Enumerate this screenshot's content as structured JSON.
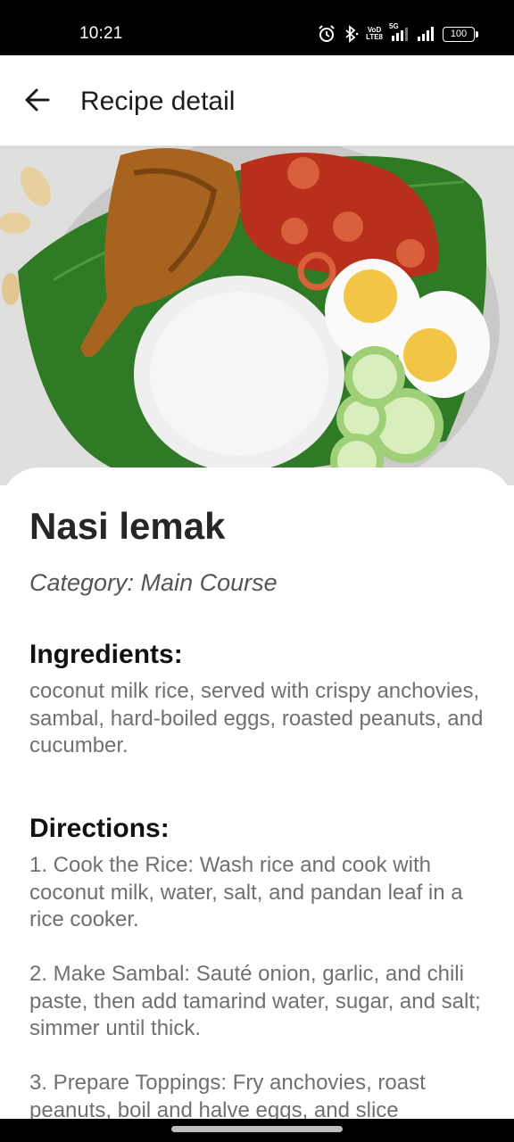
{
  "status_bar": {
    "time": "10:21",
    "icons": [
      "alarm-icon",
      "bluetooth-icon",
      "volte-icon",
      "signal-5g-icon",
      "signal-icon",
      "battery-icon"
    ],
    "volte_label_top": "VoD",
    "volte_label_bottom": "LTE8",
    "network_label": "5G",
    "battery_level": "100"
  },
  "app_bar": {
    "title": "Recipe detail",
    "back_icon": "arrow-left-icon"
  },
  "recipe": {
    "name": "Nasi lemak",
    "category": "Category: Main Course",
    "ingredients_title": "Ingredients:",
    "ingredients_text": "coconut milk rice, served with crispy anchovies, sambal, hard-boiled eggs, roasted peanuts, and cucumber.",
    "directions_title": "Directions:",
    "directions": [
      "1. Cook the Rice: Wash rice and cook with coconut milk, water, salt, and pandan leaf in a rice cooker.",
      "2. Make Sambal: Sauté onion, garlic, and chili paste, then add tamarind water, sugar, and salt; simmer until thick.",
      "3. Prepare Toppings: Fry anchovies, roast peanuts, boil and halve eggs, and slice"
    ]
  },
  "colors": {
    "status_bar_bg": "#000000",
    "app_bar_bg": "#ffffff",
    "body_text": "#707070",
    "heading_text": "#111111"
  }
}
